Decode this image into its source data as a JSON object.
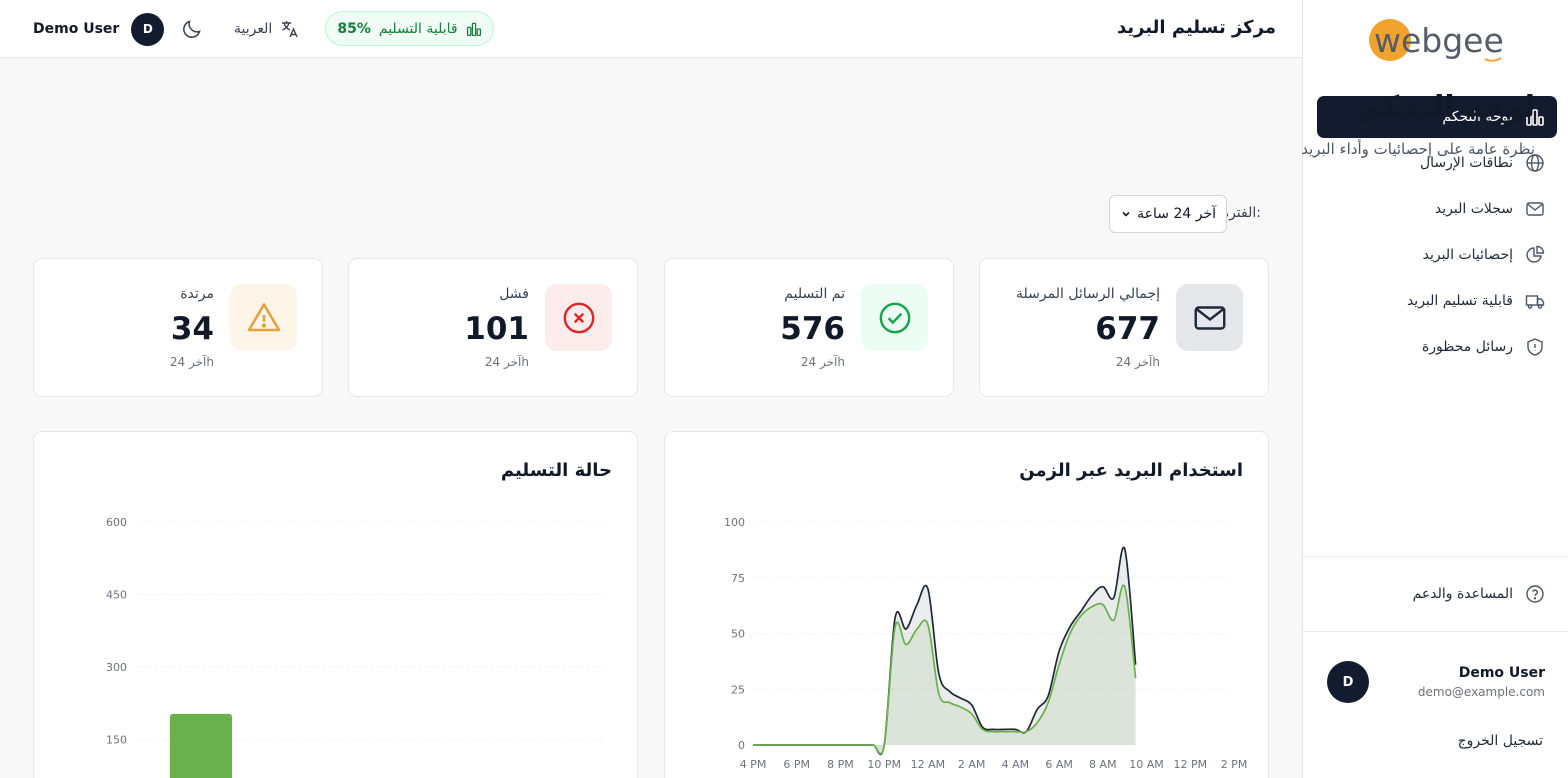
{
  "sidebar": {
    "logo_text": "webgee",
    "nav": [
      {
        "label": "لوحة التحكم",
        "icon": "bar-chart-icon",
        "active": true
      },
      {
        "label": "نطاقات الإرسال",
        "icon": "globe-icon",
        "active": false
      },
      {
        "label": "سجلات البريد",
        "icon": "mail-icon",
        "active": false
      },
      {
        "label": "إحصائيات البريد",
        "icon": "pie-chart-icon",
        "active": false
      },
      {
        "label": "قابلية تسليم البريد",
        "icon": "truck-icon",
        "active": false
      },
      {
        "label": "رسائل محظورة",
        "icon": "shield-icon",
        "active": false
      }
    ],
    "help_label": "المساعدة والدعم",
    "user": {
      "initial": "D",
      "name": "Demo User",
      "email": "demo@example.com"
    },
    "logout_label": "تسجيل الخروج"
  },
  "header": {
    "title": "مركز تسليم البريد",
    "deliverability_label": "قابلية التسليم",
    "deliverability_value": "85%",
    "language_label": "العربية",
    "user_name": "Demo User",
    "user_initial": "D"
  },
  "page": {
    "title": "لوحة التحكم",
    "subtitle": "نظرة عامة على إحصائيات وأداء البريد",
    "period_label": "الفترة:",
    "period_value": "آخر 24 ساعة"
  },
  "cards": [
    {
      "label": "إجمالي الرسائل المرسلة",
      "value": "677",
      "period": "آخر 24h",
      "icon": "mail-icon",
      "color": "#1f2937",
      "bg": "#e5e7eb"
    },
    {
      "label": "تم التسليم",
      "value": "576",
      "period": "آخر 24h",
      "icon": "check-circle-icon",
      "color": "#16a34a",
      "bg": "#ecfdf3"
    },
    {
      "label": "فشل",
      "value": "101",
      "period": "آخر 24h",
      "icon": "x-circle-icon",
      "color": "#dc2626",
      "bg": "#fdecec"
    },
    {
      "label": "مرتدة",
      "value": "34",
      "period": "آخر 24h",
      "icon": "warning-icon",
      "color": "#e8a13a",
      "bg": "#fdf5e8"
    }
  ],
  "colors": {
    "accent": "#131c2e",
    "success": "#16a34a",
    "series_sent": "#1f2937",
    "series_delivered": "#6ab04c"
  },
  "chart_data": [
    {
      "type": "area",
      "title": "استخدام البريد عبر الزمن",
      "x_ticks": [
        "4 PM",
        "6 PM",
        "8 PM",
        "10 PM",
        "12 AM",
        "2 AM",
        "4 AM",
        "6 AM",
        "8 AM",
        "10 AM",
        "12 PM",
        "2 PM"
      ],
      "x": [
        16,
        16.5,
        17,
        17.5,
        18,
        18.5,
        19,
        19.5,
        20,
        20.5,
        21,
        21.5,
        22,
        22.5,
        23,
        23.5,
        24,
        24.5,
        25,
        25.5,
        26,
        26.5,
        27,
        27.5,
        28,
        28.5,
        29,
        29.5,
        30,
        30.5,
        31,
        31.5,
        32,
        32.5,
        33,
        33.5,
        34,
        34.5,
        35,
        35.5,
        36,
        36.5,
        37,
        37.5,
        38,
        38.5
      ],
      "series": [
        {
          "values": [
            0,
            0,
            0,
            0,
            0,
            0,
            0,
            0,
            0,
            0,
            0,
            0,
            0,
            57,
            52,
            63,
            70,
            32,
            24,
            21,
            18,
            8,
            7,
            7,
            7,
            6,
            16,
            22,
            42,
            53,
            60,
            67,
            71,
            66,
            88,
            36
          ]
        },
        {
          "values": [
            0,
            0,
            0,
            0,
            0,
            0,
            0,
            0,
            0,
            0,
            0,
            0,
            0,
            53,
            45,
            52,
            54,
            23,
            19,
            17,
            14,
            7,
            6,
            6,
            6,
            6,
            10,
            19,
            36,
            50,
            58,
            62,
            63,
            56,
            71,
            30
          ]
        }
      ],
      "ylim": [
        0,
        100
      ],
      "y_ticks": [
        0,
        25,
        50,
        75,
        100
      ]
    },
    {
      "type": "bar",
      "title": "حالة التسليم",
      "ylim": [
        0,
        600
      ],
      "y_ticks": [
        0,
        150,
        300,
        450,
        600
      ],
      "values": [
        203
      ]
    }
  ]
}
